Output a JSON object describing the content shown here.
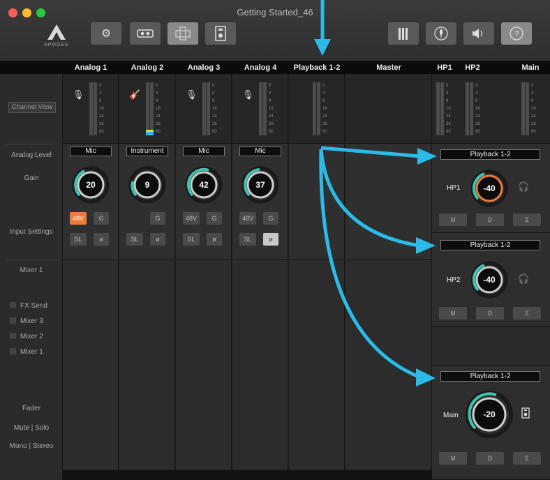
{
  "window": {
    "title": "Getting Started_46"
  },
  "logo": {
    "text": "APOGEE"
  },
  "header": {
    "columns": [
      "Analog 1",
      "Analog 2",
      "Analog 3",
      "Analog 4",
      "Playback 1-2",
      "Master",
      "HP1",
      "HP2",
      "Main"
    ]
  },
  "sidebar": {
    "channel_view": "Channel View",
    "analog_level": "Analog Level",
    "gain": "Gain",
    "input_settings": "Input Settings",
    "mixer1_title": "Mixer 1",
    "mixer_items": [
      "FX Send",
      "Mixer 3",
      "Mixer 2",
      "Mixer 1"
    ],
    "fader": "Fader",
    "mute_solo": "Mute | Solo",
    "mono_stereo": "Mono | Stereo"
  },
  "meter_scale": [
    "0",
    "3",
    "9",
    "16",
    "24",
    "36",
    "60"
  ],
  "channels": [
    {
      "source": "Mic",
      "gain": "20",
      "btn_48v": "48V",
      "btn_g": "G",
      "btn_sl": "SL",
      "btn_phase": "ø"
    },
    {
      "source": "Instrument",
      "gain": "9",
      "btn_g": "G",
      "btn_sl": "SL",
      "btn_phase": "ø"
    },
    {
      "source": "Mic",
      "gain": "42",
      "btn_48v": "48V",
      "btn_g": "G",
      "btn_sl": "SL",
      "btn_phase": "ø"
    },
    {
      "source": "Mic",
      "gain": "37",
      "btn_48v": "48V",
      "btn_g": "G",
      "btn_sl": "SL",
      "btn_phase": "ø"
    }
  ],
  "outputs": [
    {
      "source": "Playback 1-2",
      "label": "HP1",
      "level": "-40",
      "m": "M",
      "d": "D",
      "sum": "Σ"
    },
    {
      "source": "Playback 1-2",
      "label": "HP2",
      "level": "-40",
      "m": "M",
      "d": "D",
      "sum": "Σ"
    },
    {
      "source": "Playback 1-2",
      "label": "Main",
      "level": "-20",
      "m": "M",
      "d": "D",
      "sum": "Σ"
    }
  ],
  "colors": {
    "accent": "#2bbbe8",
    "orange": "#ef7a3a",
    "knob_ring": "#3ec4b0"
  }
}
